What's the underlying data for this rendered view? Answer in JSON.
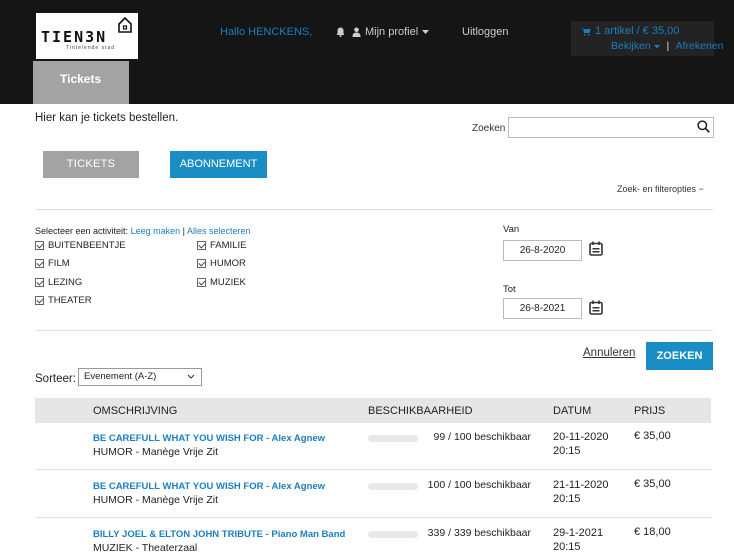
{
  "header": {
    "logo_text": "TIEN3N",
    "logo_sub": "Tintelende stad",
    "greeting": "Hallo HENCKENS,",
    "profile_label": "Mijn profiel",
    "logout_label": "Uitloggen",
    "cart_summary": "1 artikel / € 35,00",
    "cart_view": "Bekijken",
    "cart_sep": "|",
    "cart_checkout": "Afrekenen",
    "tab_label": "Tickets"
  },
  "intro_text": "Hier kan je tickets bestellen.",
  "search": {
    "label": "Zoeken",
    "value": ""
  },
  "mode_buttons": {
    "tickets": "TICKETS",
    "abonnement": "ABONNEMENT"
  },
  "filter_toggle": "Zoek- en filteropties −",
  "activity": {
    "label": "Selecteer een activiteit:",
    "clear": "Leeg maken",
    "sep": "|",
    "select_all": "Alles selecteren",
    "options": [
      {
        "label": "BUITENBEENTJE",
        "checked": true
      },
      {
        "label": "FAMILIE",
        "checked": true
      },
      {
        "label": "FILM",
        "checked": true
      },
      {
        "label": "HUMOR",
        "checked": true
      },
      {
        "label": "LEZING",
        "checked": true
      },
      {
        "label": "MUZIEK",
        "checked": true
      },
      {
        "label": "THEATER",
        "checked": true
      }
    ]
  },
  "dates": {
    "from_label": "Van",
    "from_value": "26-8-2020",
    "to_label": "Tot",
    "to_value": "26-8-2021"
  },
  "actions": {
    "cancel": "Annuleren",
    "search": "ZOEKEN"
  },
  "sort": {
    "label": "Sorteer:",
    "selected": "Evenement (A-Z)"
  },
  "table": {
    "headers": [
      "OMSCHRIJVING",
      "BESCHIKBAARHEID",
      "DATUM",
      "PRIJS"
    ],
    "rows": [
      {
        "title": "BE CAREFULL WHAT YOU WISH FOR - Alex Agnew",
        "subtitle": "HUMOR - Manège Vrije Zit",
        "availability": "99 / 100 beschikbaar",
        "available_fraction": 0.99,
        "date": "20-11-2020",
        "time": "20:15",
        "price": "€ 35,00"
      },
      {
        "title": "BE CAREFULL WHAT YOU WISH FOR - Alex Agnew",
        "subtitle": "HUMOR - Manège Vrije Zit",
        "availability": "100 / 100 beschikbaar",
        "available_fraction": 1.0,
        "date": "21-11-2020",
        "time": "20:15",
        "price": "€ 35,00"
      },
      {
        "title": "BILLY JOEL & ELTON JOHN TRIBUTE - Piano Man Band",
        "subtitle": "MUZIEK - Theaterzaal",
        "availability": "339 / 339 beschikbaar",
        "available_fraction": 1.0,
        "date": "29-1-2021",
        "time": "20:15",
        "price": "€ 18,00"
      }
    ]
  },
  "colors": {
    "accent": "#1a8ec4",
    "link": "#1a7fc0",
    "header_bg": "#151515",
    "muted_button": "#a3a3a3"
  }
}
